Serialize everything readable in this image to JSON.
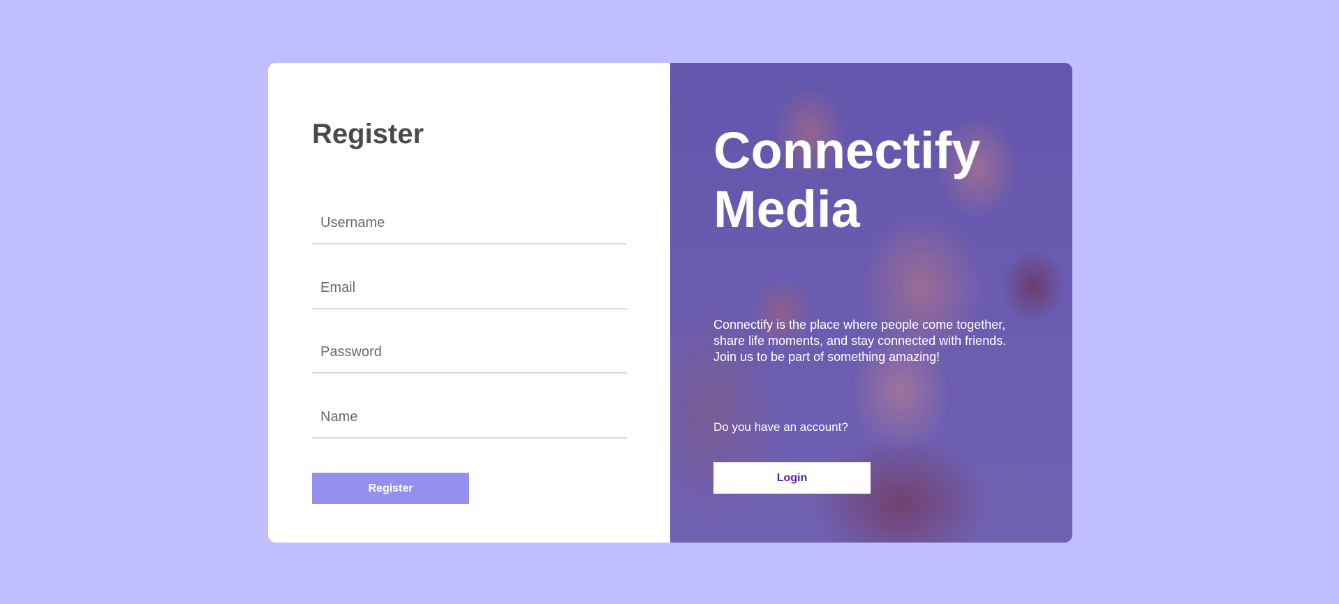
{
  "register": {
    "title": "Register",
    "fields": [
      {
        "name": "username",
        "placeholder": "Username",
        "value": ""
      },
      {
        "name": "email",
        "placeholder": "Email",
        "value": ""
      },
      {
        "name": "password",
        "placeholder": "Password",
        "value": ""
      },
      {
        "name": "name",
        "placeholder": "Name",
        "value": ""
      }
    ],
    "button_label": "Register"
  },
  "promo": {
    "brand": "Connectify Media",
    "tagline": "Connectify is the place where people come together, share life moments, and stay connected with friends. Join us to be part of something amazing!",
    "account_question": "Do you have an account?",
    "login_label": "Login"
  },
  "colors": {
    "page_background": "#c1befe",
    "register_button": "#9590ef",
    "overlay": "#5c2e96",
    "login_text": "#5a1a9a",
    "title_text": "#4a4a48"
  }
}
